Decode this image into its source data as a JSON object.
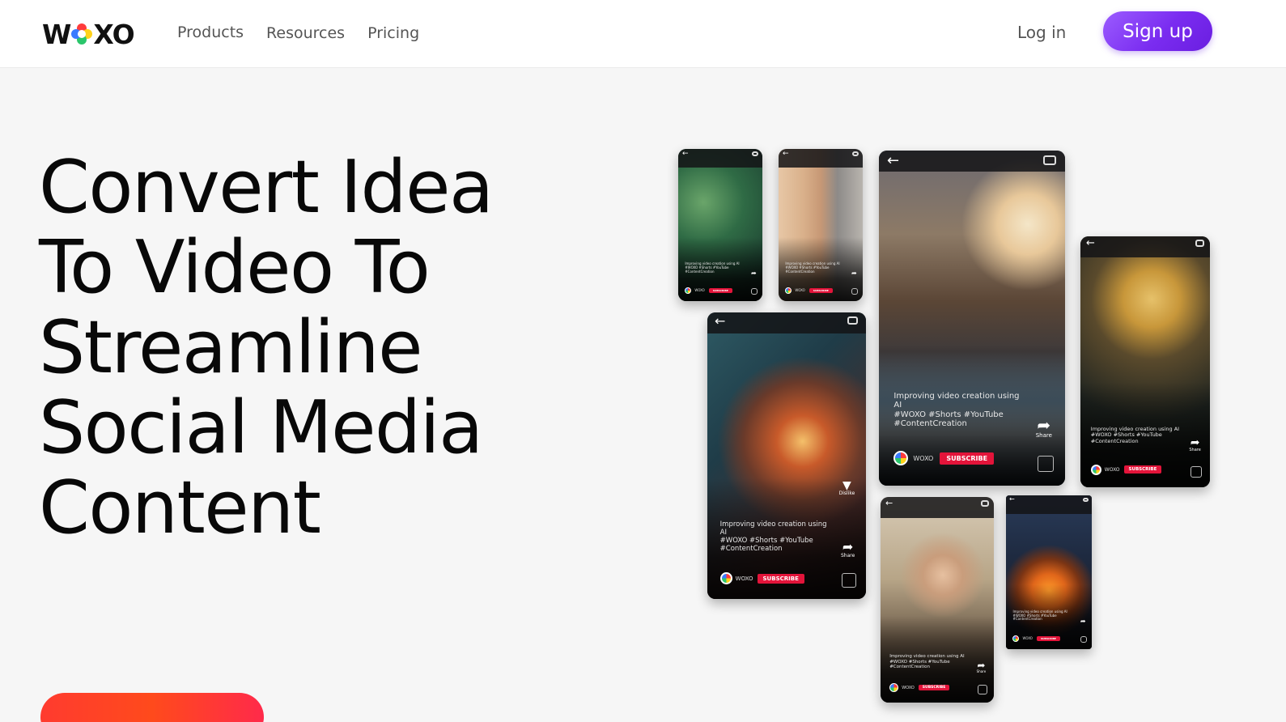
{
  "header": {
    "logo_left": "W",
    "logo_right": "XO",
    "nav": [
      "Products",
      "Resources",
      "Pricing"
    ],
    "login_label": "Log in",
    "signup_label": "Sign up"
  },
  "hero": {
    "headline_lines": [
      "Convert Idea",
      "To Video To",
      "Streamline",
      "Social Media",
      "Content"
    ]
  },
  "phones": {
    "caption_line1": "Improving video creation using AI",
    "caption_line2": "#WOXO #Shorts #YouTube",
    "caption_line3": "#ContentCreation",
    "brand": "WOXO",
    "subscribe": "SUBSCRIBE",
    "share": "Share",
    "dislike": "Dislike"
  },
  "colors": {
    "signup_gradient": [
      "#9b5cff",
      "#6a1ee0"
    ],
    "cta_gradient": [
      "#ff3b2f",
      "#ff2a4a"
    ],
    "subscribe_red": "#e3143a"
  },
  "icons": {
    "back": "back-arrow-icon",
    "camera": "camera-icon",
    "share": "share-icon",
    "dislike": "dislike-icon"
  }
}
